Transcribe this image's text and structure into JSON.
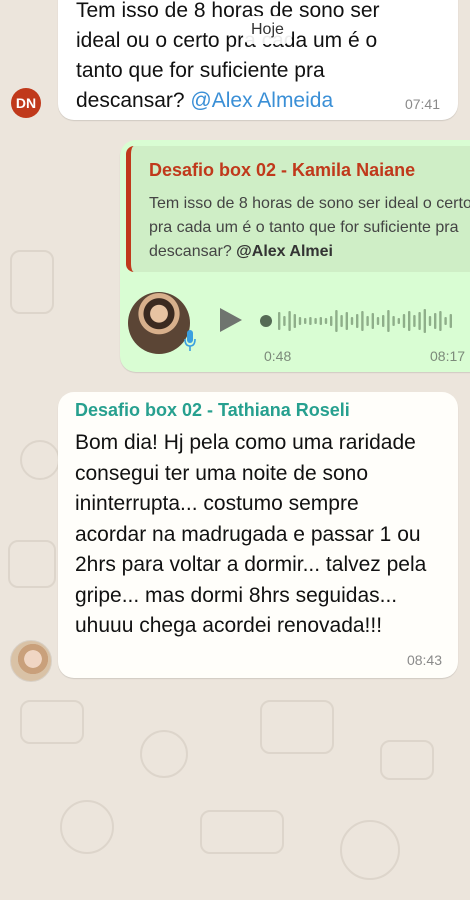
{
  "date_chip": "Hoje",
  "messages": [
    {
      "text": "Tem isso de 8 horas de sono ser ideal ou o certo pra cada um é o tanto que for suficiente pra descansar?",
      "mention": "@Alex Almeida",
      "time": "07:41",
      "avatar_initials": "DN"
    },
    {
      "quote_author": "Desafio box 02 - Kamila  Naiane",
      "quote_text": "Tem isso de 8 horas de sono ser ideal o certo pra cada um é o tanto que for suficiente pra descansar?",
      "quote_mention": "@Alex Almei",
      "voice_duration": "0:48",
      "time": "08:17"
    },
    {
      "author": "Desafio box 02 - Tathiana  Roseli",
      "text": "Bom dia! Hj pela como uma raridade consegui ter uma noite de sono ininterrupta... costumo sempre acordar na madrugada e passar 1 ou 2hrs para voltar a dormir... talvez pela gripe... mas dormi 8hrs seguidas... uhuuu chega acordei renovada!!!",
      "time": "08:43"
    }
  ],
  "colors": {
    "background": "#ece5dc",
    "outgoing_bubble": "#d9fdd3",
    "incoming_bubble": "#fffefa",
    "quote_author": "#c0391b",
    "author_teal": "#27a08f",
    "mention_blue": "#3a8fd6"
  },
  "icons": [
    "play-icon",
    "mic-icon",
    "audio-waveform"
  ]
}
